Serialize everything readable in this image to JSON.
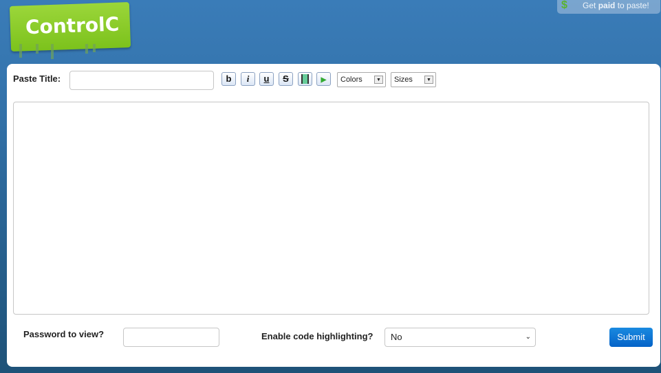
{
  "logo": {
    "text": "ControlC"
  },
  "promo": {
    "prefix": "Get ",
    "bold": "paid",
    "suffix": " to paste!",
    "icon": "dollar-icon"
  },
  "form": {
    "title_label": "Paste Title:",
    "title_value": "",
    "toolbar": {
      "bold": "b",
      "italic": "i",
      "underline": "u",
      "strike": "S",
      "colors": "Colors",
      "sizes": "Sizes"
    },
    "content": "",
    "password_label": "Password to view?",
    "password_value": "",
    "highlight_label": "Enable code highlighting?",
    "highlight_value": "No",
    "submit": "Submit"
  }
}
